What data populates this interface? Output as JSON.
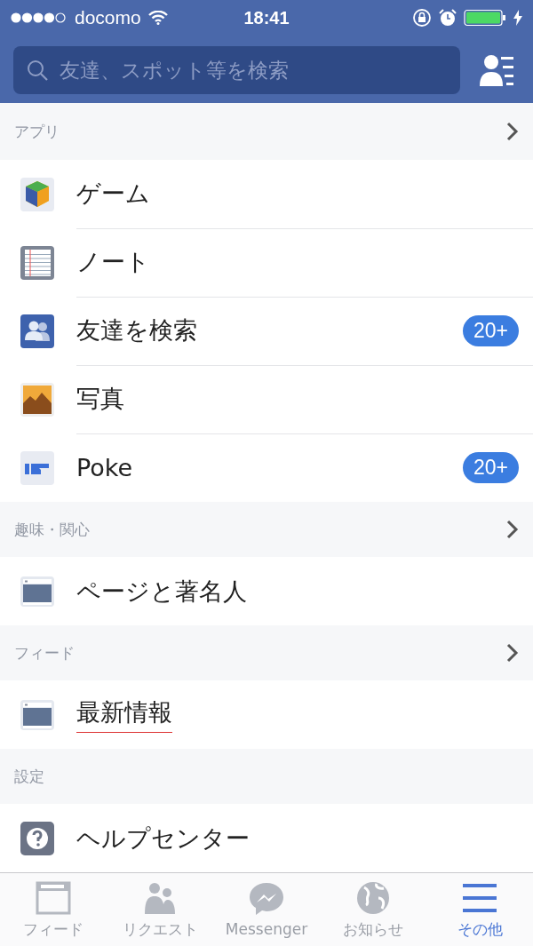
{
  "status_bar": {
    "carrier": "docomo",
    "time": "18:41"
  },
  "search": {
    "placeholder": "友達、スポット等を検索"
  },
  "sections": [
    {
      "title": "アプリ",
      "chevron": true,
      "items": [
        {
          "kind": "game",
          "label": "ゲーム"
        },
        {
          "kind": "note",
          "label": "ノート"
        },
        {
          "kind": "friends",
          "label": "友達を検索",
          "badge": "20+"
        },
        {
          "kind": "photo",
          "label": "写真"
        },
        {
          "kind": "poke",
          "label": "Poke",
          "badge": "20+"
        }
      ]
    },
    {
      "title": "趣味・関心",
      "chevron": true,
      "items": [
        {
          "kind": "page",
          "label": "ページと著名人"
        }
      ]
    },
    {
      "title": "フィード",
      "chevron": true,
      "items": [
        {
          "kind": "page",
          "label": "最新情報",
          "underlined": true
        }
      ]
    },
    {
      "title": "設定",
      "chevron": false,
      "items": [
        {
          "kind": "help",
          "label": "ヘルプセンター"
        }
      ]
    }
  ],
  "tabs": [
    {
      "kind": "feed",
      "label": "フィード",
      "selected": false
    },
    {
      "kind": "requests",
      "label": "リクエスト",
      "selected": false
    },
    {
      "kind": "messenger",
      "label": "Messenger",
      "selected": false
    },
    {
      "kind": "globe",
      "label": "お知らせ",
      "selected": false
    },
    {
      "kind": "menu",
      "label": "その他",
      "selected": true
    }
  ]
}
